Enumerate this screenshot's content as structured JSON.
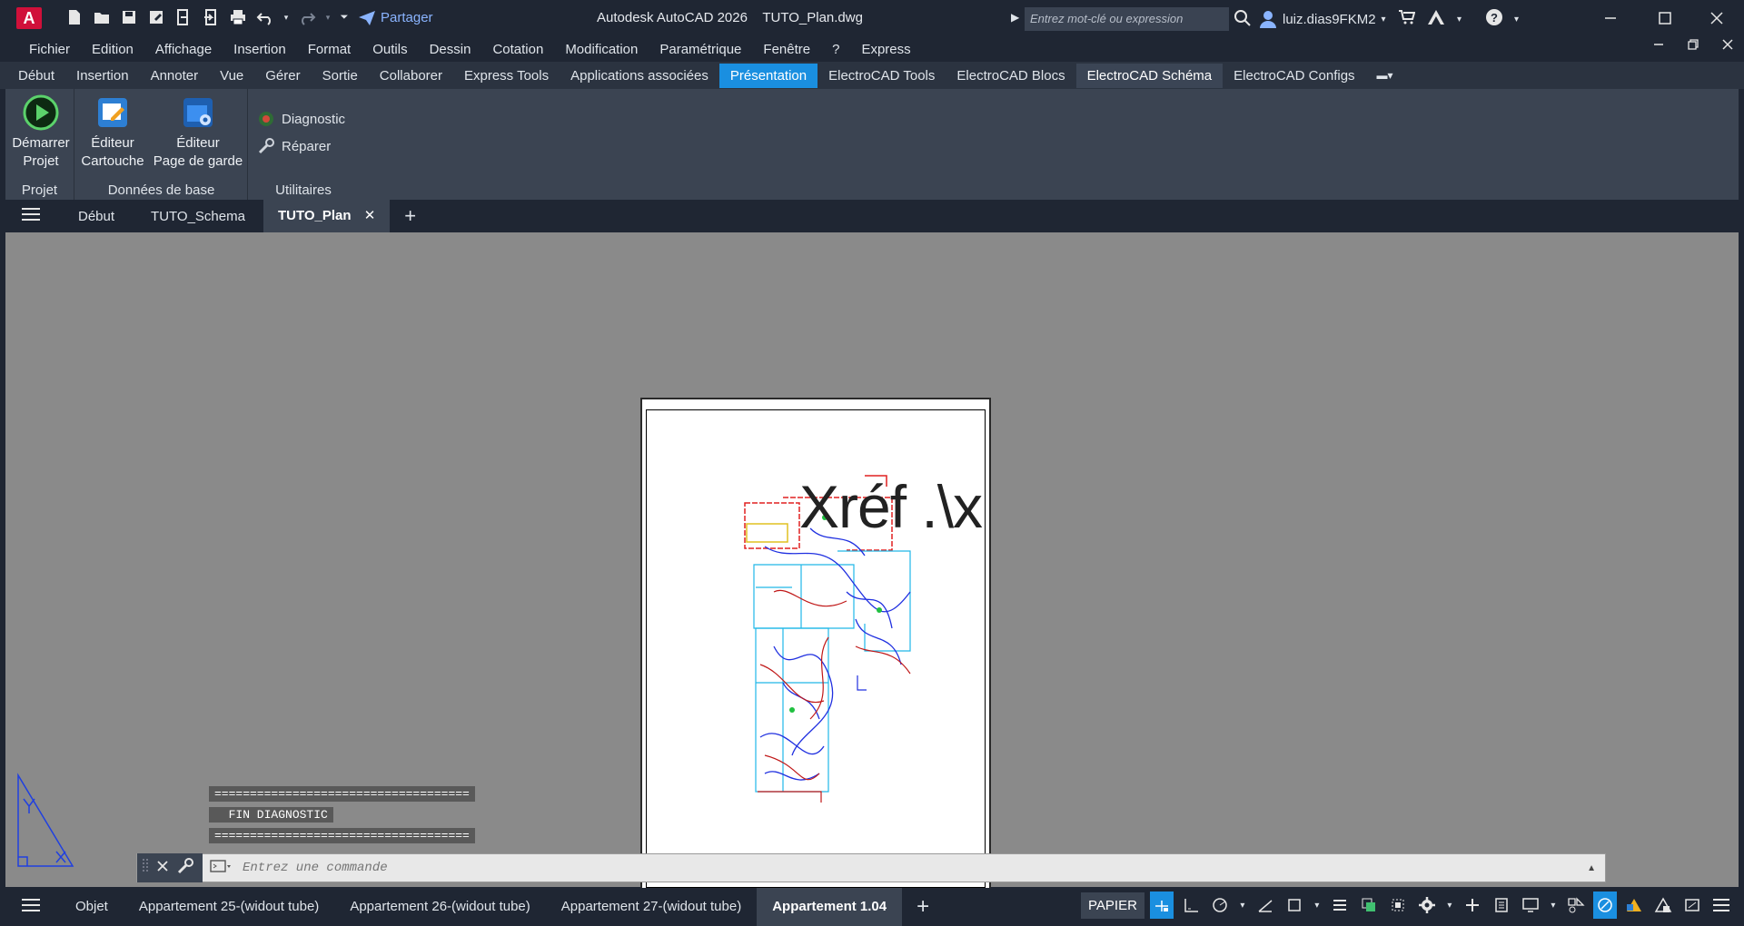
{
  "app": {
    "logo_letter": "A",
    "share_label": "Partager",
    "title": "Autodesk AutoCAD 2026    TUTO_Plan.dwg",
    "search_placeholder": "Entrez mot-clé ou expression",
    "user_name": "luiz.dias9FKM2"
  },
  "menu": [
    "Fichier",
    "Edition",
    "Affichage",
    "Insertion",
    "Format",
    "Outils",
    "Dessin",
    "Cotation",
    "Modification",
    "Paramétrique",
    "Fenêtre",
    "?",
    "Express"
  ],
  "ribbon_tabs": [
    {
      "label": "Début",
      "state": "normal"
    },
    {
      "label": "Insertion",
      "state": "normal"
    },
    {
      "label": "Annoter",
      "state": "normal"
    },
    {
      "label": "Vue",
      "state": "normal"
    },
    {
      "label": "Gérer",
      "state": "normal"
    },
    {
      "label": "Sortie",
      "state": "normal"
    },
    {
      "label": "Collaborer",
      "state": "normal"
    },
    {
      "label": "Express Tools",
      "state": "normal"
    },
    {
      "label": "Applications associées",
      "state": "normal"
    },
    {
      "label": "Présentation",
      "state": "active"
    },
    {
      "label": "ElectroCAD Tools",
      "state": "normal"
    },
    {
      "label": "ElectroCAD Blocs",
      "state": "normal"
    },
    {
      "label": "ElectroCAD Schéma",
      "state": "selected"
    },
    {
      "label": "ElectroCAD Configs",
      "state": "normal"
    }
  ],
  "ribbon": {
    "projet_title": "Projet",
    "demarrer_l1": "Démarrer",
    "demarrer_l2": "Projet",
    "donnees_title": "Données de base",
    "cartouche_l1": "Éditeur",
    "cartouche_l2": "Cartouche",
    "garde_l1": "Éditeur",
    "garde_l2": "Page de garde",
    "utilitaires_title": "Utilitaires",
    "diagnostic": "Diagnostic",
    "reparer": "Réparer"
  },
  "file_tabs": [
    {
      "label": "Début",
      "active": false
    },
    {
      "label": "TUTO_Schema",
      "active": false
    },
    {
      "label": "TUTO_Plan",
      "active": true
    }
  ],
  "drawing": {
    "xref_text": "Xréf .\\x"
  },
  "command": {
    "separator": "====================================",
    "message": "  FIN DIAGNOSTIC",
    "placeholder": "Entrez une commande"
  },
  "layout_tabs": [
    {
      "label": "Objet",
      "active": false
    },
    {
      "label": "Appartement 25-(widout tube)",
      "active": false
    },
    {
      "label": "Appartement 26-(widout tube)",
      "active": false
    },
    {
      "label": "Appartement 27-(widout tube)",
      "active": false
    },
    {
      "label": "Appartement 1.04",
      "active": true
    }
  ],
  "status": {
    "space": "PAPIER"
  },
  "colors": {
    "accent": "#1a8fe0",
    "chrome": "#1f2633",
    "ribbon": "#3b4452",
    "canvas": "#8a8a8a"
  }
}
